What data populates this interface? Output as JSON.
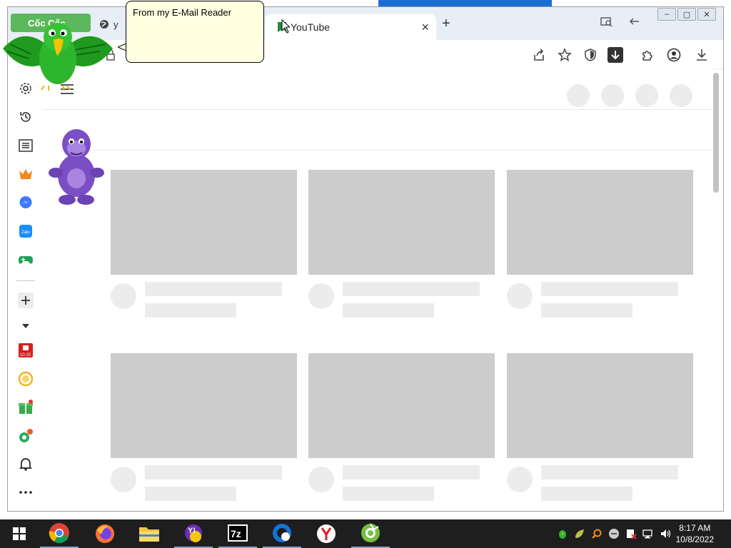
{
  "browser": {
    "brand_tab_label": "Cốc Cốc",
    "inactive_tab_label": "y",
    "active_tab_title": "YouTube",
    "new_tab": "+",
    "close_tab": "×"
  },
  "callout": {
    "text": "From my E-Mail Reader"
  },
  "taskbar": {
    "clock_time": "8:17 AM",
    "clock_date": "10/8/2022",
    "apps": [
      "windows-start",
      "chrome",
      "firefox",
      "file-explorer",
      "yahoo-messenger",
      "7zip",
      "edge-quick",
      "yandex",
      "coccoc"
    ]
  },
  "colors": {
    "taskbar": "#1e1e1e",
    "placeholder_thumb": "#cccccc",
    "placeholder_line": "#ececec",
    "callout_bg": "#ffffe1",
    "brand_green": "#5cb85c"
  },
  "icons": {
    "sidebar": [
      "gear-icon",
      "history-icon",
      "reading-list-icon",
      "crown-icon",
      "messenger-icon",
      "zalo-icon",
      "gamepad-icon",
      "plus-icon",
      "chevron-down-icon",
      "shopping-1010-icon",
      "clock-coin-icon",
      "gift-icon",
      "map-pin-icon",
      "bell-icon",
      "more-icon"
    ],
    "toolbar": [
      "share-icon",
      "bookmark-star-icon",
      "shield-icon",
      "download-arrow-icon",
      "extensions-icon",
      "profile-icon",
      "download-icon"
    ]
  }
}
